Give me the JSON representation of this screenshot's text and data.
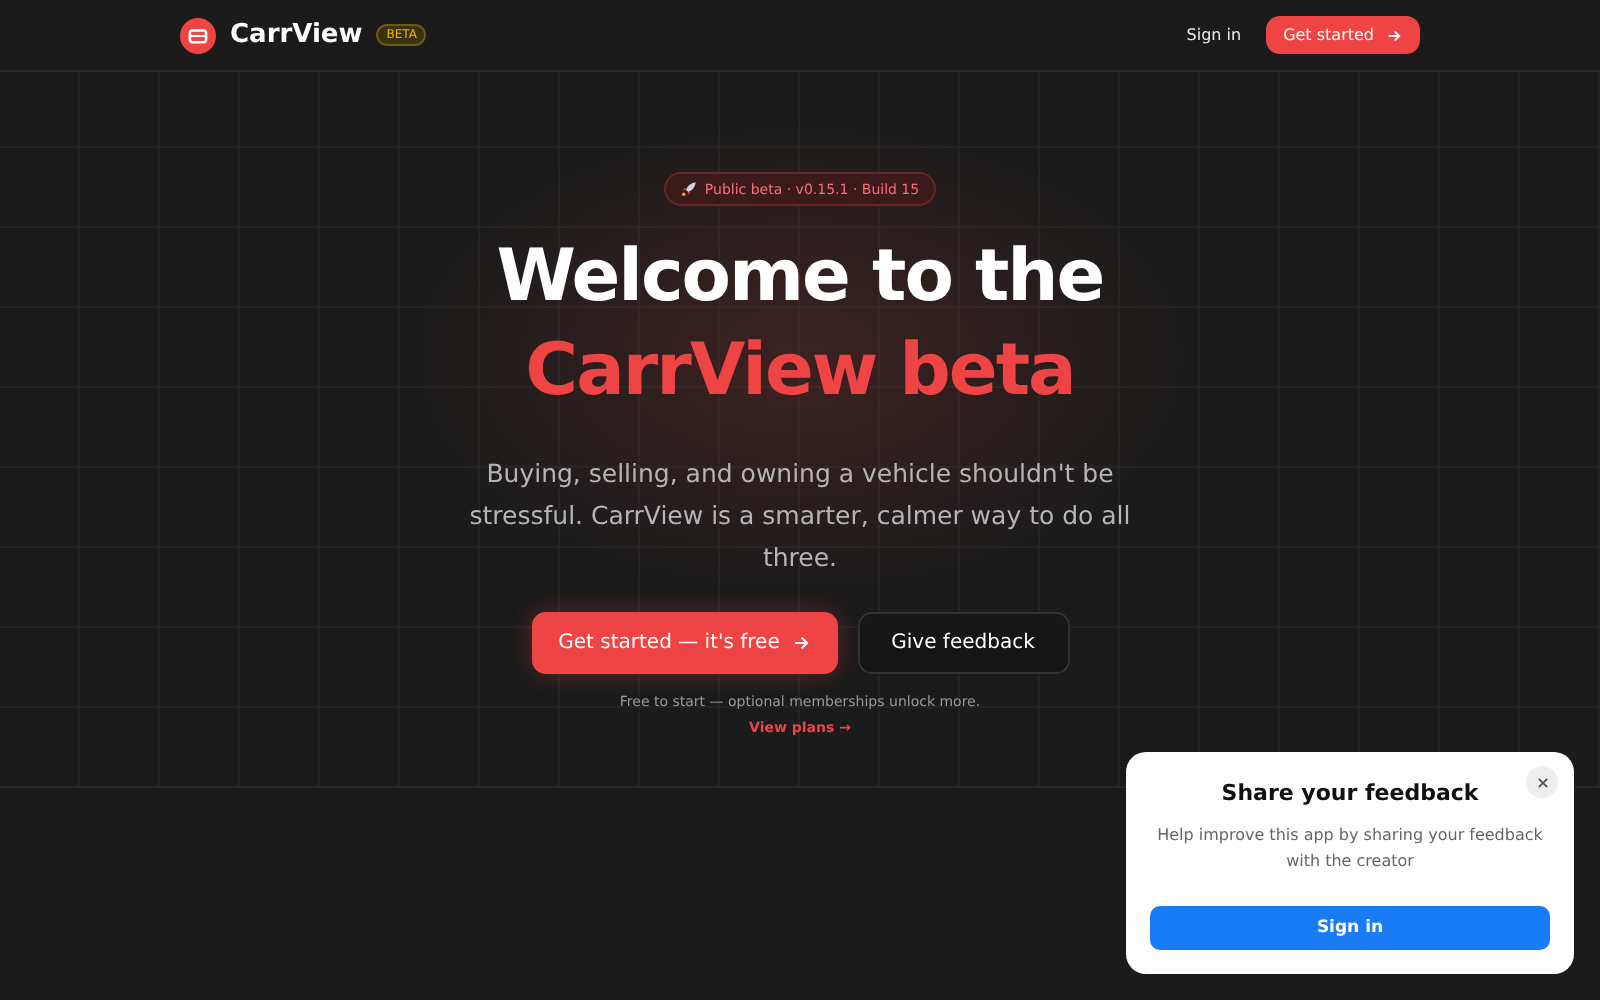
{
  "nav": {
    "brand": "CarrView",
    "brand_badge": "BETA",
    "sign_in": "Sign in",
    "cta": "Get started"
  },
  "hero": {
    "pill": "Public beta · v0.15.1 · Build 15",
    "title": "Welcome to the",
    "title_accent": "CarrView beta",
    "subtitle": "Buying, selling, and owning a vehicle shouldn't be stressful. CarrView is a smarter, calmer way to do all three.",
    "primary_button": "Get started — it's free",
    "secondary_button": "Give feedback",
    "note": "Free to start — optional memberships unlock more.",
    "link": "View plans →"
  },
  "feedback_popup": {
    "title": "Share your feedback",
    "text": "Help improve this app by sharing your feedback with the creator",
    "button": "Sign in"
  }
}
